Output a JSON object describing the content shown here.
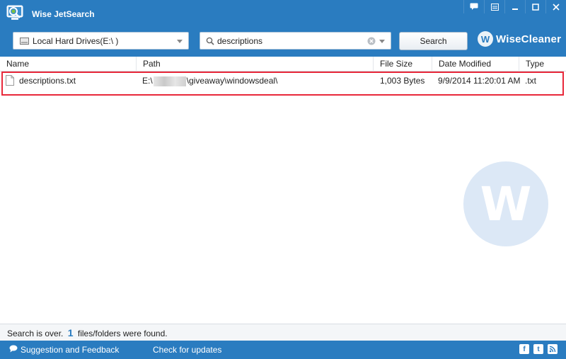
{
  "app": {
    "title": "Wise JetSearch"
  },
  "toolbar": {
    "drive_label": "Local Hard Drives(E:\\ )",
    "search_value": "descriptions",
    "search_button": "Search",
    "brand_text": "WiseCleaner",
    "brand_mark": "W"
  },
  "columns": [
    "Name",
    "Path",
    "File Size",
    "Date Modified",
    "Type"
  ],
  "results": [
    {
      "name": "descriptions.txt",
      "path_prefix": "E:\\",
      "path_suffix": "\\giveaway\\windowsdeal\\",
      "size": "1,003 Bytes",
      "modified": "9/9/2014 11:20:01 AM",
      "type": ".txt"
    }
  ],
  "watermark": {
    "letter": "W"
  },
  "status": {
    "prefix": "Search is over.",
    "count": "1",
    "suffix": "files/folders were found."
  },
  "footer": {
    "feedback": "Suggestion and Feedback",
    "updates": "Check for updates"
  },
  "colors": {
    "accent": "#2a7cc0",
    "highlight": "#e8283a"
  },
  "icons": [
    "app-logo-icon",
    "feedback-icon",
    "skin-icon",
    "minimize-icon",
    "close-icon",
    "drive-icon",
    "search-icon",
    "clear-icon",
    "file-icon",
    "speech-bubble-icon",
    "facebook-icon",
    "twitter-icon",
    "rss-icon"
  ]
}
